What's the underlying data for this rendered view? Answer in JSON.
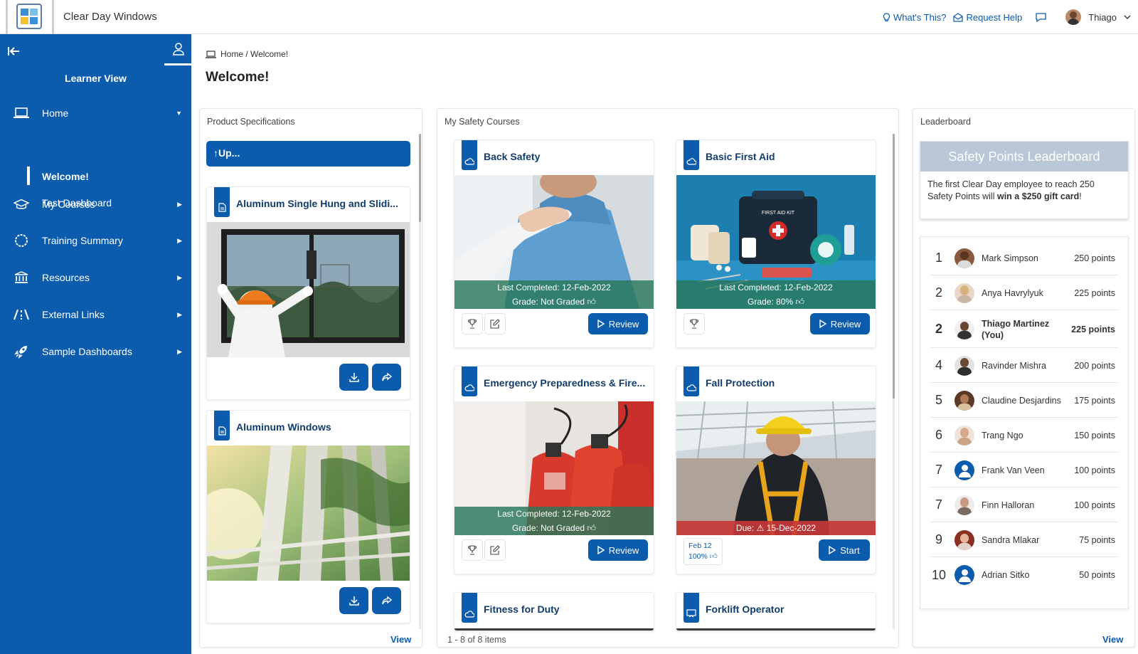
{
  "app": {
    "name": "Clear Day Windows"
  },
  "topbar": {
    "whats_this": "What's This?",
    "request_help": "Request Help",
    "user_name": "Thiago"
  },
  "sidebar": {
    "title": "Learner View",
    "items": [
      {
        "label": "Home",
        "icon": "laptop-icon"
      },
      {
        "label": "My Courses",
        "icon": "graduation-cap-icon"
      },
      {
        "label": "Training Summary",
        "icon": "circle-icon"
      },
      {
        "label": "Resources",
        "icon": "bank-icon"
      },
      {
        "label": "External Links",
        "icon": "road-icon"
      },
      {
        "label": "Sample Dashboards",
        "icon": "rocket-icon"
      }
    ],
    "sub_items": [
      "Welcome!",
      "Test Dashboard"
    ]
  },
  "breadcrumb": "Home / Welcome!",
  "page_title": "Welcome!",
  "product_specs": {
    "title": "Product Specifications",
    "up_label": "↑Up...",
    "cards": [
      {
        "title": "Aluminum Single Hung and Slidi..."
      },
      {
        "title": "Aluminum Windows"
      }
    ],
    "view_label": "View"
  },
  "courses": {
    "title": "My Safety Courses",
    "cards": [
      {
        "title": "Back Safety",
        "line1": "Last Completed: 12-Feb-2022",
        "line2": "Grade: Not Graded",
        "action": "Review"
      },
      {
        "title": "Basic First Aid",
        "line1": "Last Completed: 12-Feb-2022",
        "line2": "Grade: 80%",
        "action": "Review",
        "kit_label": "FIRST AID KIT"
      },
      {
        "title": "Emergency Preparedness & Fire...",
        "line1": "Last Completed: 12-Feb-2022",
        "line2": "Grade: Not Graded",
        "action": "Review"
      },
      {
        "title": "Fall Protection",
        "due": "Due:",
        "due_date": "15-Dec-2022",
        "action": "Start",
        "progress_date": "Feb 12",
        "progress_pct": "100%"
      },
      {
        "title": "Fitness for Duty"
      },
      {
        "title": "Forklift Operator"
      }
    ],
    "items_count": "1 - 8 of 8 items"
  },
  "leaderboard": {
    "title": "Leaderboard",
    "banner_title": "Safety Points Leaderboard",
    "banner_text": "The first Clear Day employee to reach 250 Safety Points will ",
    "banner_bold": "win a $250 gift card",
    "banner_end": "!",
    "rows": [
      {
        "rank": "1",
        "name": "Mark Simpson",
        "points": "250 points"
      },
      {
        "rank": "2",
        "name": "Anya Havrylyuk",
        "points": "225 points"
      },
      {
        "rank": "2",
        "name": "Thiago Martinez (You)",
        "points": "225 points"
      },
      {
        "rank": "4",
        "name": "Ravinder Mishra",
        "points": "200 points"
      },
      {
        "rank": "5",
        "name": "Claudine Desjardins",
        "points": "175 points"
      },
      {
        "rank": "6",
        "name": "Trang Ngo",
        "points": "150 points"
      },
      {
        "rank": "7",
        "name": "Frank Van Veen",
        "points": "100 points"
      },
      {
        "rank": "7",
        "name": "Finn Halloran",
        "points": "100 points"
      },
      {
        "rank": "9",
        "name": "Sandra Mlakar",
        "points": "75 points"
      },
      {
        "rank": "10",
        "name": "Adrian Sitko",
        "points": "50 points"
      }
    ],
    "view_label": "View"
  },
  "colors": {
    "brand": "#0b5cad",
    "overlay_green": "#28785a",
    "overlay_red": "#c83737"
  }
}
